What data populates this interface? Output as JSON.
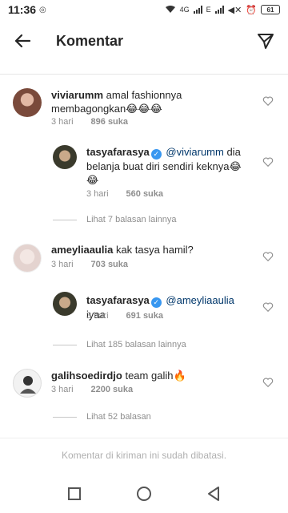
{
  "status_bar": {
    "time": "11:36",
    "network_label": "4G",
    "network_label_2": "E",
    "battery": "61"
  },
  "header": {
    "title": "Komentar"
  },
  "comments": [
    {
      "username": "viviarumm",
      "text": "amal fashionnya membagongkan😂😂😂",
      "time": "3 hari",
      "likes": "896 suka",
      "avatar_color": "#9a6b5a"
    },
    {
      "username": "tasyafarasya",
      "mention": "@viviarumm",
      "text": " dia belanja buat diri sendiri keknya😂😂",
      "time": "3 hari",
      "likes": "560 suka",
      "avatar_color": "#6d6a4e"
    },
    {
      "view_more": "Lihat 7 balasan lainnya"
    },
    {
      "username": "ameyliaaulia",
      "text": "kak tasya hamil?",
      "time": "3 hari",
      "likes": "703 suka",
      "avatar_color": "#e9dcd8"
    },
    {
      "username": "tasyafarasya",
      "mention": "@ameyliaaulia",
      "text": " iyaa",
      "time": "3 hari",
      "likes": "691 suka",
      "avatar_color": "#6d6a4e"
    },
    {
      "view_more": "Lihat 185 balasan lainnya"
    },
    {
      "username": "galihsoedirdjo",
      "text": "team galih🔥",
      "time": "3 hari",
      "likes": "2200 suka",
      "avatar_color": "#d8d8d8"
    },
    {
      "view_more": "Lihat 52 balasan"
    }
  ],
  "footer": {
    "note": "Komentar di kiriman ini sudah dibatasi."
  },
  "icons": {
    "back": "arrow-left-icon",
    "send": "paper-plane-icon",
    "like": "heart-outline-icon",
    "verified": "verified-badge-icon",
    "nav_recents": "square-icon",
    "nav_home": "circle-icon",
    "nav_back": "triangle-back-icon"
  }
}
